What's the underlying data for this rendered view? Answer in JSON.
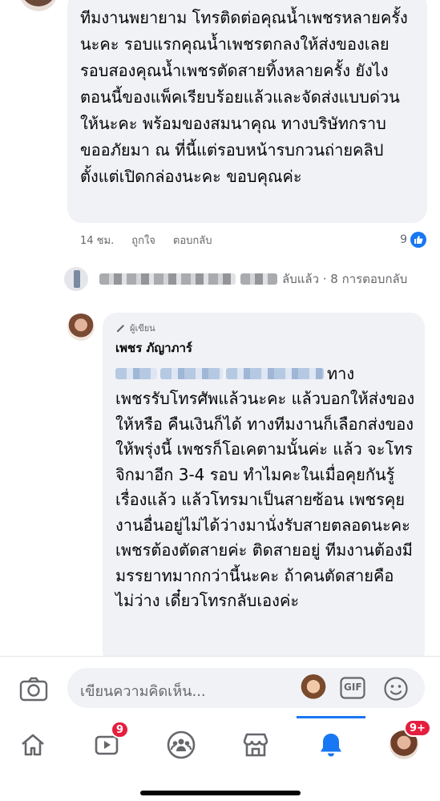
{
  "comment_1": {
    "text": "ทีมงานพยายาม โทรติดต่อคุณน้ำเพชรหลายครั้งนะคะ รอบแรกคุณน้ำเพชรตกลงให้ส่งของเลย รอบสองคุณน้ำเพชรตัดสายทิ้งหลายครั้ง ยังไงตอนนี้ของแพ็คเรียบร้อยแล้วและจัดส่งแบบด่วนให้นะคะ พร้อมของสมนาคุณ ทางบริษัทกราบขออภัยมา ณ ที่นี้แต่รอบหน้ารบกวนถ่ายคลิปตั้งแต่เปิดกล่องนะคะ ขอบคุณค่ะ",
    "time": "14 ชม.",
    "like_label": "ถูกใจ",
    "reply_label": "ตอบกลับ",
    "like_count": "9"
  },
  "replies_summary": {
    "text": "ลับแล้ว · 8 การตอบกลับ"
  },
  "comment_2": {
    "author_tag": "ผู้เขียน",
    "author_name": "เพชร ภัญาภาร์",
    "mention_after": "ทาง",
    "text": "เพชรรับโทรศัพแล้วนะคะ แล้วบอกให้ส่งของให้หรือ คืนเงินก็ได้ ทางทีมงานก็เลือกส่งของให้พรุ่งนี้ เพชรก็โอเคตามนั้นค่ะ แล้ว จะโทรจิกมาอีก 3-4 รอบ ทำไมคะในเมื่อคุยกันรู้เรื่องแล้ว แล้วโทรมาเป็นสายซ้อน เพชรคุยงานอื่นอยู่ไม่ได้ว่างมานั่งรับสายตลอดนะคะ เพชรต้องตัดสายค่ะ ติดสายอยู่ ทีมงานต้องมีมรรยาทมากกว่านี้นะคะ ถ้าคนตัดสายคือ ไม่ว่าง เดี๋ยวโทรกลับเองค่ะ"
  },
  "composer": {
    "placeholder": "เขียนความคิดเห็น...",
    "gif_label": "GIF"
  },
  "nav": {
    "items": [
      {
        "icon": "home-icon"
      },
      {
        "icon": "video-icon",
        "badge": "9"
      },
      {
        "icon": "groups-icon"
      },
      {
        "icon": "marketplace-icon"
      },
      {
        "icon": "bell-icon",
        "active": true
      },
      {
        "icon": "profile-avatar",
        "badge": "9+"
      }
    ]
  },
  "colors": {
    "accent": "#1877f2",
    "bubble": "#f0f2f5",
    "badge": "#e41e3f",
    "meta_text": "#65676b"
  }
}
